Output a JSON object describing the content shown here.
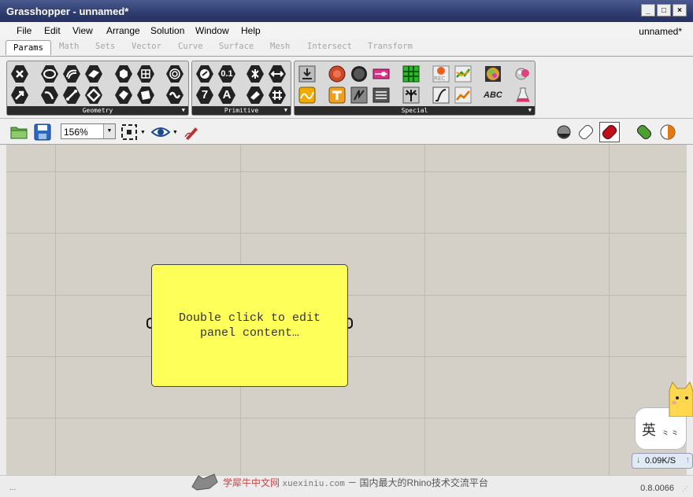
{
  "window": {
    "title": "Grasshopper - unnamed*",
    "controls": [
      "_",
      "□",
      "×"
    ]
  },
  "menu": {
    "items": [
      "File",
      "Edit",
      "View",
      "Arrange",
      "Solution",
      "Window",
      "Help"
    ],
    "document_name": "unnamed*"
  },
  "tabs": [
    {
      "label": "Params",
      "active": true
    },
    {
      "label": "Math"
    },
    {
      "label": "Sets"
    },
    {
      "label": "Vector"
    },
    {
      "label": "Curve"
    },
    {
      "label": "Surface"
    },
    {
      "label": "Mesh"
    },
    {
      "label": "Intersect"
    },
    {
      "label": "Transform"
    }
  ],
  "ribbon": {
    "groups": [
      {
        "label": "Geometry"
      },
      {
        "label": "Primitive"
      },
      {
        "label": "Special"
      }
    ],
    "primitive_icons": {
      "number": "0.1",
      "integer": "7",
      "text": "A"
    },
    "special_icons": {
      "record": "REC",
      "text_tag": "ABC"
    }
  },
  "canvas_toolbar": {
    "zoom": "156%"
  },
  "panel": {
    "line1": "Double click to edit",
    "line2": "panel content…",
    "color": "#ffff5a"
  },
  "status": {
    "watermark_cn": "学犀牛中文网",
    "watermark_en": "xuexiniu.com",
    "watermark_sep": "－",
    "watermark_tail": "国内最大的Rhino技术交流平台",
    "version": "0.8.0066",
    "left": "..."
  },
  "overlay": {
    "ime_char": "英",
    "ime_extra": "⺀⺀",
    "speed": "0.09K/S",
    "down_arrow": "↓",
    "up_arrow": "↑"
  },
  "colors": {
    "titlebar": "#2e3b6e",
    "canvas": "#d4d0c8",
    "grid": "#bdbab2"
  }
}
